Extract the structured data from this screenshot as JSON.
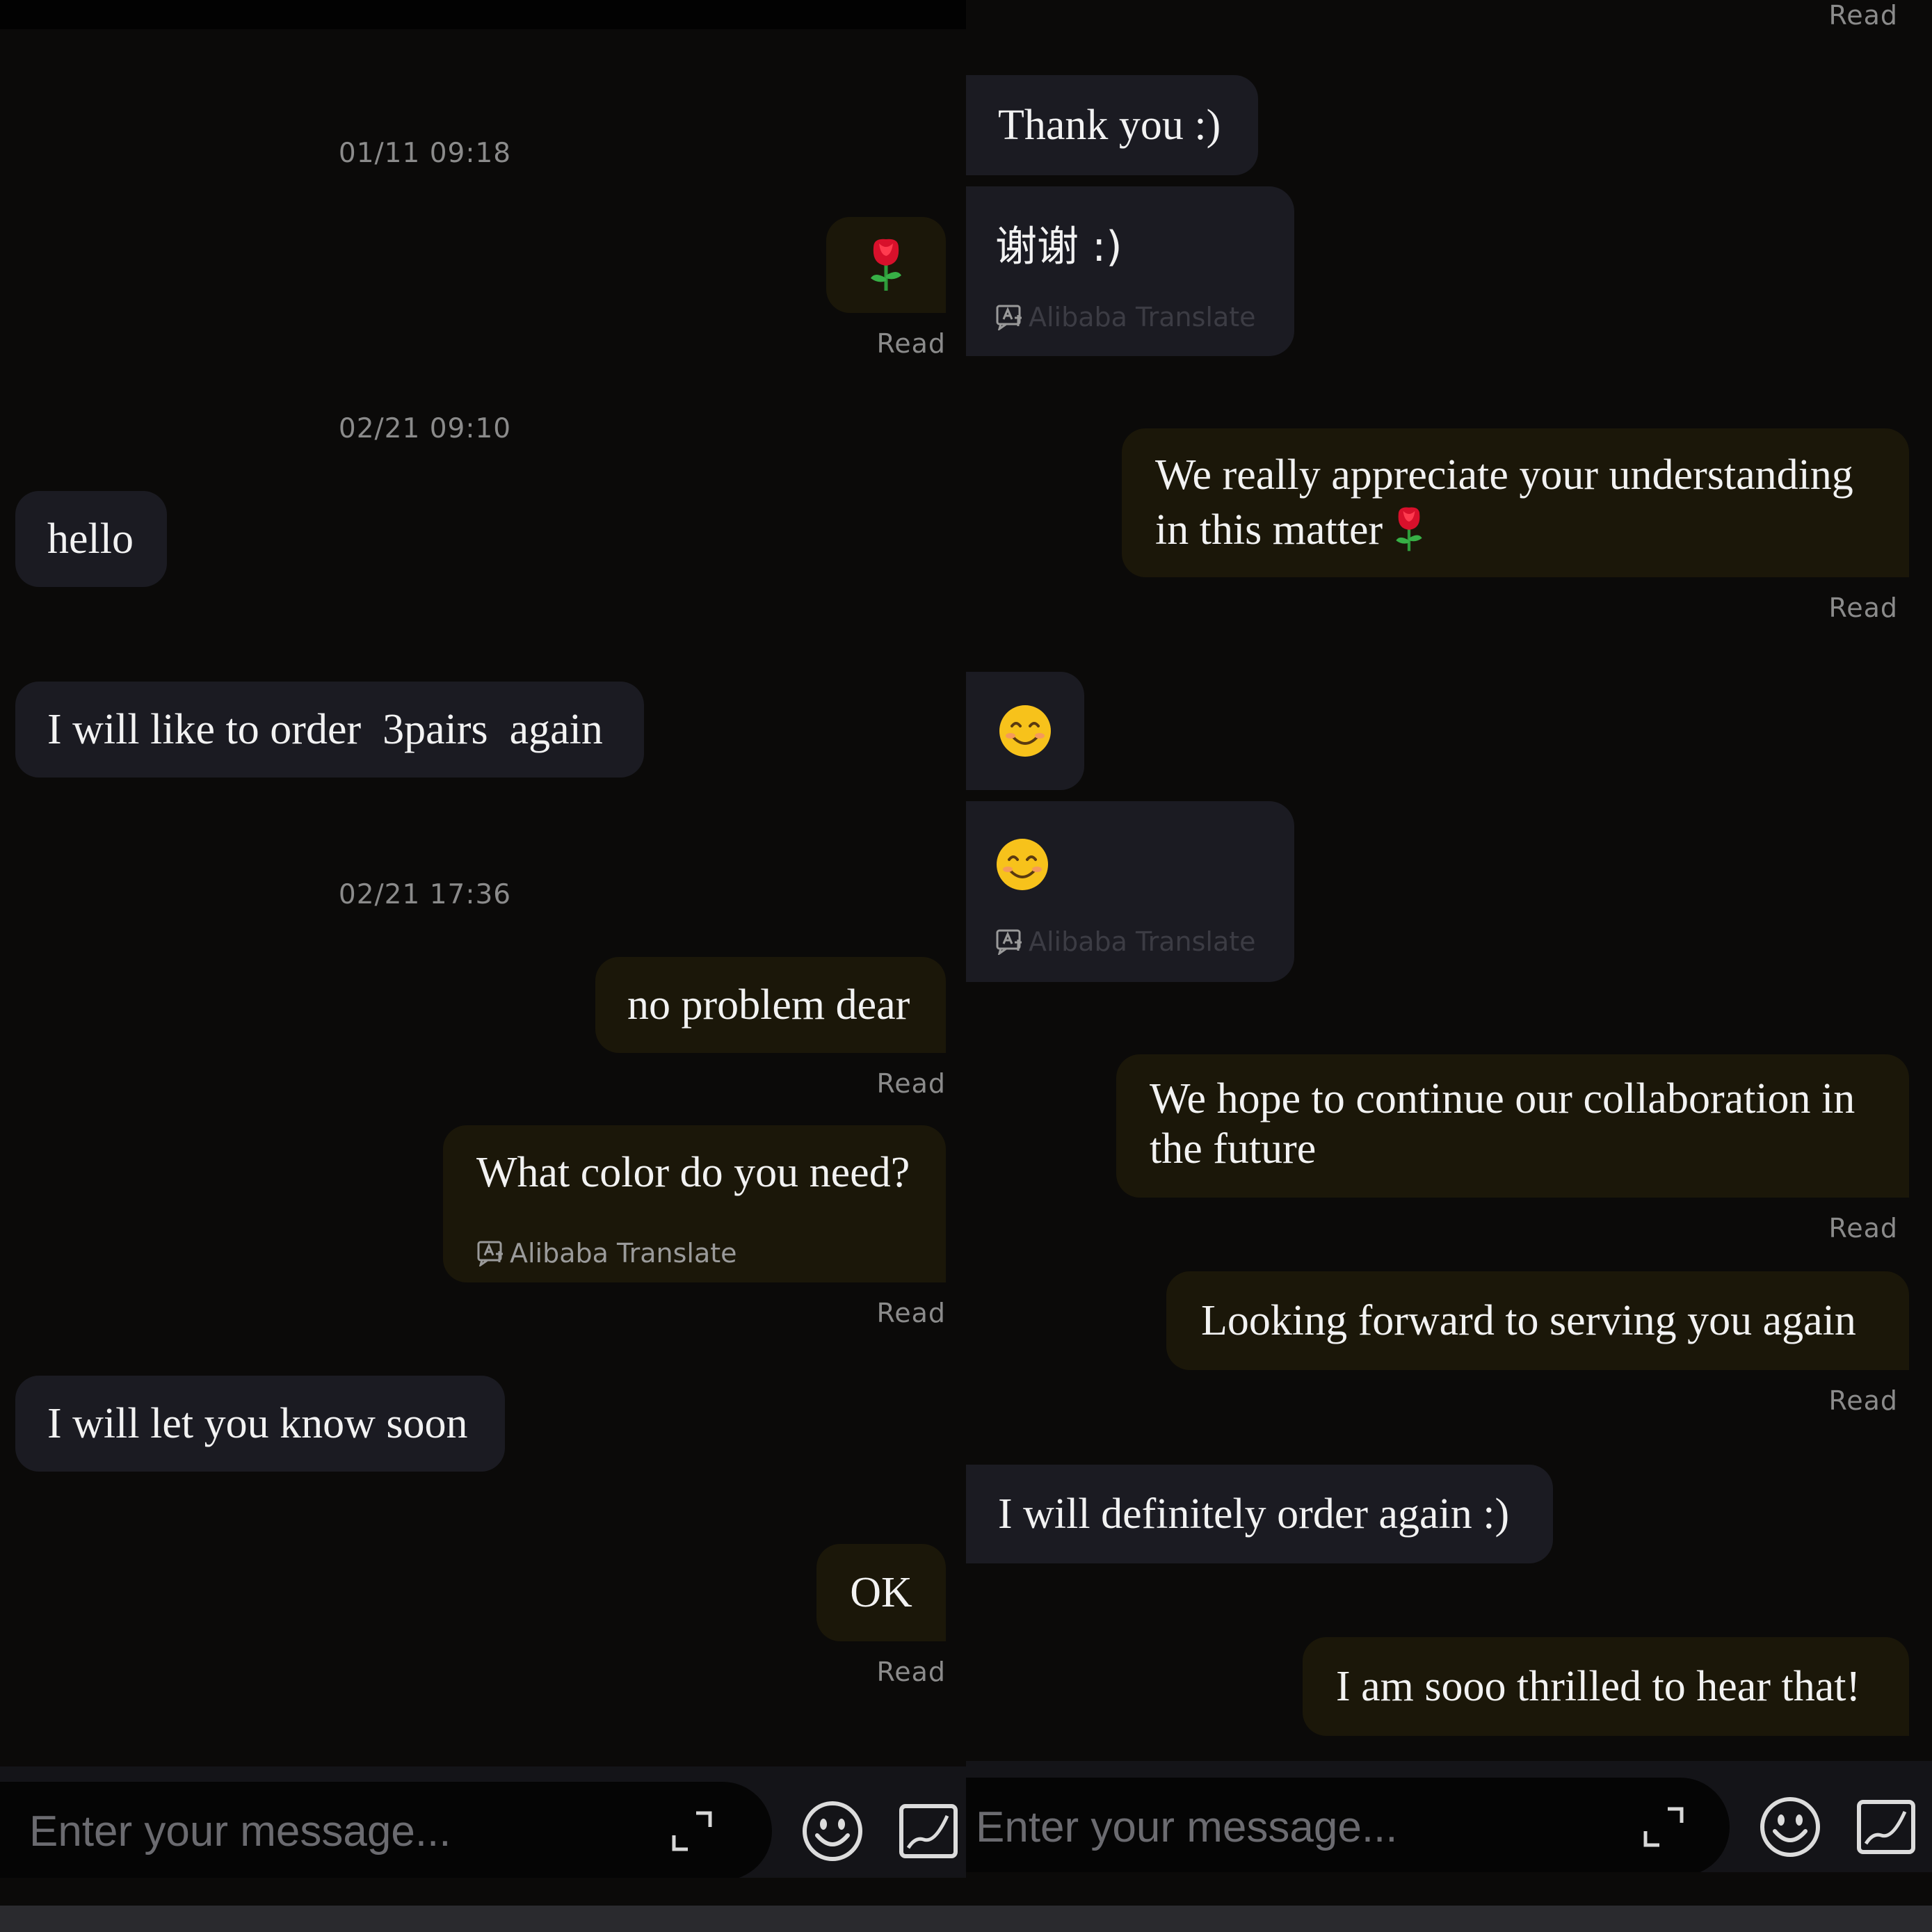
{
  "left": {
    "timestamps": [
      "01/11 09:18",
      "02/21 09:10",
      "02/21 17:36"
    ],
    "messages": {
      "hello": "hello",
      "order": "I will like to order  3pairs  again",
      "no_problem": "no problem dear",
      "color": "What color do you need?",
      "let_know": "I will let you know soon",
      "ok": "OK"
    },
    "read_label": "Read",
    "translate_label": "Alibaba Translate",
    "input_placeholder": "Enter your message..."
  },
  "right": {
    "messages": {
      "thank_you": "Thank you :)",
      "thank_you_translated": "谢谢 :)",
      "appreciate": "We really appreciate your understanding in this matter",
      "collaboration": "We hope to continue our collaboration in the future",
      "looking_forward": "Looking forward to serving you again",
      "order_again": "I will definitely order again :)",
      "thrilled": "I am sooo thrilled to hear that!"
    },
    "read_label": "Read",
    "translate_label": "Alibaba Translate",
    "input_placeholder": "Enter your message..."
  },
  "colors": {
    "background": "#0b0a09",
    "incoming_bubble": "#1b1b22",
    "outgoing_bubble": "#1b1709",
    "meta_text": "#8b8b8b"
  },
  "icons": [
    "rose-emoji",
    "smiling-face-emoji",
    "translate-icon",
    "expand-icon",
    "emoji-icon",
    "image-icon"
  ]
}
